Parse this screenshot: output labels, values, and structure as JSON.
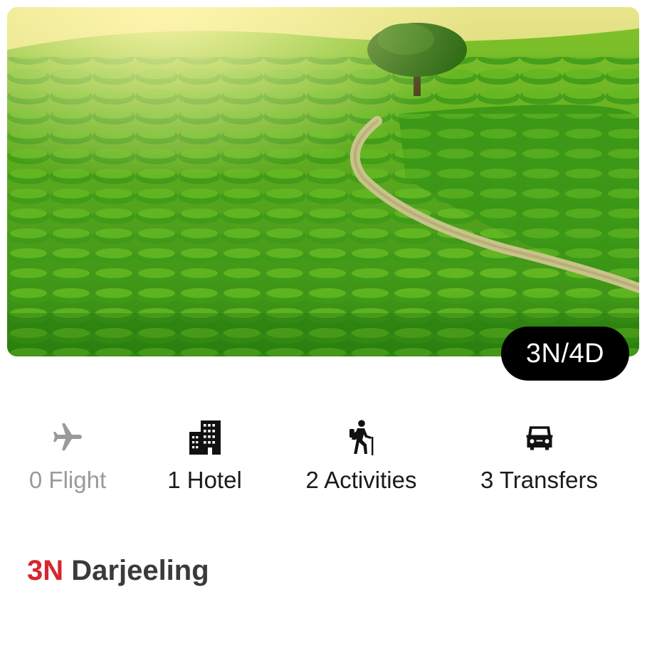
{
  "package": {
    "duration_badge": "3N/4D",
    "features": {
      "flight": {
        "label": "0 Flight",
        "icon": "airplane-icon",
        "active": false
      },
      "hotel": {
        "label": "1 Hotel",
        "icon": "building-icon",
        "active": true
      },
      "activities": {
        "label": "2 Activities",
        "icon": "hiker-icon",
        "active": true
      },
      "transfers": {
        "label": "3 Transfers",
        "icon": "car-icon",
        "active": true
      }
    },
    "itinerary": {
      "nights": "3N",
      "city": "Darjeeling"
    }
  },
  "colors": {
    "accent_red": "#d7262f",
    "disabled_gray": "#9a9a9a",
    "badge_bg": "#000000"
  }
}
